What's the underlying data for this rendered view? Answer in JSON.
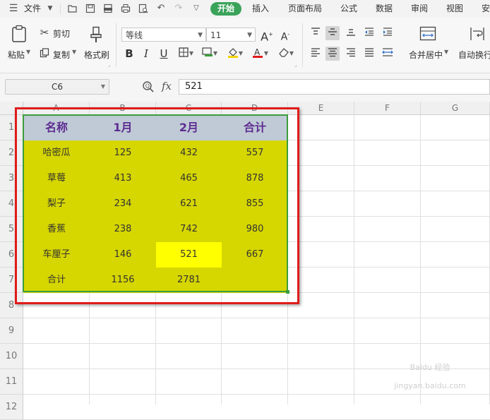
{
  "menubar": {
    "file_label": "文件",
    "tabs": [
      "开始",
      "插入",
      "页面布局",
      "公式",
      "数据",
      "审阅",
      "视图",
      "安"
    ]
  },
  "ribbon": {
    "paste": "粘贴",
    "cut": "剪切",
    "copy": "复制",
    "format_painter": "格式刷",
    "font_name": "等线",
    "font_size": "11",
    "merge_center": "合并居中",
    "auto_wrap": "自动换行"
  },
  "formula_bar": {
    "cell_ref": "C6",
    "fx_label": "fx",
    "value": "521"
  },
  "sheet": {
    "columns": [
      "A",
      "B",
      "C",
      "D",
      "E",
      "F",
      "G"
    ],
    "rows": [
      "1",
      "2",
      "3",
      "4",
      "5",
      "6",
      "7",
      "8",
      "9",
      "10",
      "11",
      "12"
    ],
    "header": [
      "名称",
      "1月",
      "2月",
      "合计"
    ],
    "data": [
      [
        "哈密瓜",
        "125",
        "432",
        "557"
      ],
      [
        "草莓",
        "413",
        "465",
        "878"
      ],
      [
        "梨子",
        "234",
        "621",
        "855"
      ],
      [
        "香蕉",
        "238",
        "742",
        "980"
      ],
      [
        "车厘子",
        "146",
        "521",
        "667"
      ],
      [
        "合计",
        "1156",
        "2781",
        ""
      ]
    ]
  },
  "colors": {
    "header_fill": "#bfcad6",
    "data_fill": "#d6d600",
    "selected_fill": "#ffff00",
    "header_text": "#5e2d91",
    "range_border": "#3a9e3a",
    "annotation_box": "#e01b1b",
    "home_tab": "#3aa35a"
  },
  "watermark": "Baidu 经验 jingyan.baidu.com"
}
